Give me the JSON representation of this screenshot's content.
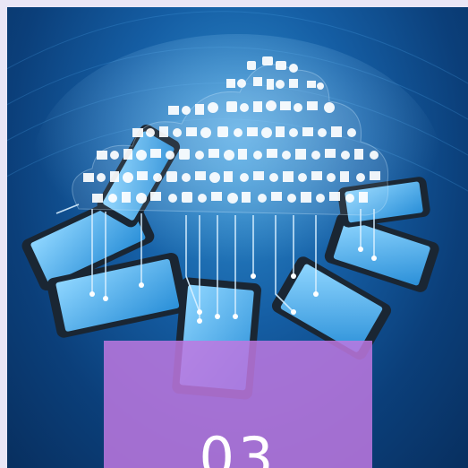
{
  "image": {
    "description_icon": "cloud-computing-devices-illustration"
  },
  "overlay": {
    "number": "03",
    "color": "#c27de6"
  }
}
